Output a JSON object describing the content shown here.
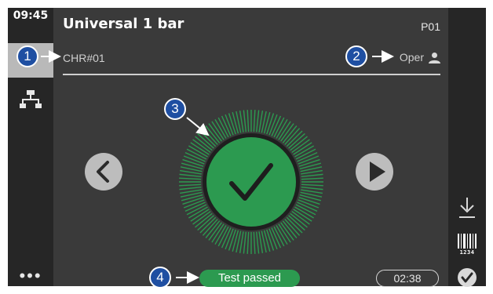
{
  "left_bar": {
    "clock": "09:45",
    "active_icon": "tag-icon",
    "network_icon": "network-icon",
    "more_label": "•••"
  },
  "header": {
    "title": "Universal 1 bar",
    "program": "P01",
    "channel": "CHR#01",
    "operator": "Oper",
    "operator_icon": "user-icon"
  },
  "result": {
    "status": "Test passed",
    "timer": "02:38",
    "indicator": "checkmark-icon"
  },
  "navigation": {
    "previous_icon": "chevron-left-icon",
    "next_icon": "play-right-icon"
  },
  "right_bar": {
    "download_icon": "download-icon",
    "barcode_icon": "barcode-icon",
    "barcode_text": "1234",
    "confirm_icon": "confirm-check-icon"
  },
  "callouts": {
    "one": "1",
    "two": "2",
    "three": "3",
    "four": "4"
  },
  "colors": {
    "accent_green": "#2c9a50",
    "callout_blue": "#1f4fa2",
    "panel": "#3a3a3a",
    "sidebar": "#262626"
  }
}
